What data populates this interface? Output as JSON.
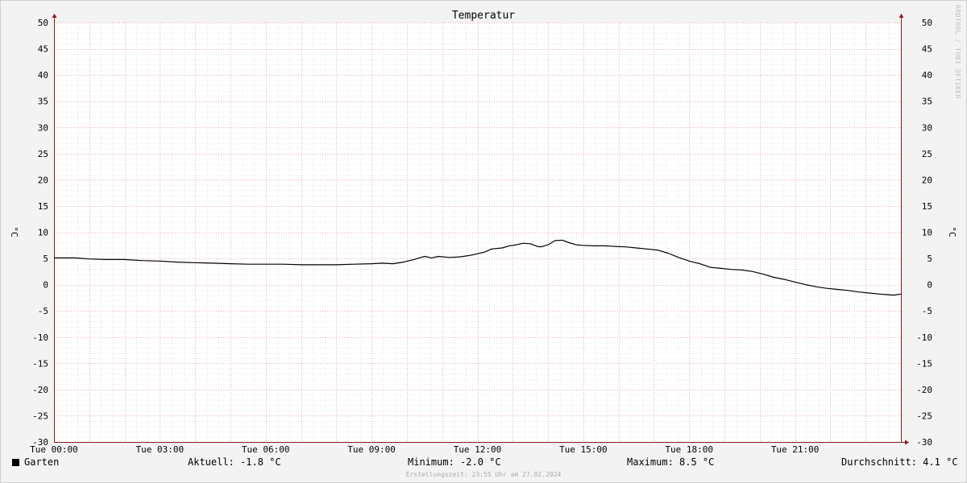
{
  "chart_data": {
    "type": "line",
    "title": "Temperatur",
    "ylabel": "°C",
    "ylabel_right": "°C",
    "ylim": [
      -30,
      50
    ],
    "yticks": [
      -30,
      -25,
      -20,
      -15,
      -10,
      -5,
      0,
      5,
      10,
      15,
      20,
      25,
      30,
      35,
      40,
      45,
      50
    ],
    "xlim": [
      0,
      24
    ],
    "xticks": [
      {
        "value": 0,
        "label": "Tue 00:00"
      },
      {
        "value": 3,
        "label": "Tue 03:00"
      },
      {
        "value": 6,
        "label": "Tue 06:00"
      },
      {
        "value": 9,
        "label": "Tue 09:00"
      },
      {
        "value": 12,
        "label": "Tue 12:00"
      },
      {
        "value": 15,
        "label": "Tue 15:00"
      },
      {
        "value": 18,
        "label": "Tue 18:00"
      },
      {
        "value": 21,
        "label": "Tue 21:00"
      }
    ],
    "grid": true,
    "legend_position": "bottom-left",
    "series": [
      {
        "name": "Garten",
        "color": "#000000",
        "x": [
          0,
          0.6,
          1,
          1.5,
          2,
          2.5,
          3,
          3.5,
          4,
          4.5,
          5,
          5.5,
          6,
          6.5,
          7,
          7.5,
          8,
          8.5,
          9,
          9.3,
          9.6,
          9.9,
          10.2,
          10.4,
          10.5,
          10.7,
          10.9,
          11.2,
          11.5,
          11.8,
          12,
          12.2,
          12.4,
          12.7,
          12.9,
          13.1,
          13.3,
          13.5,
          13.7,
          13.8,
          14.0,
          14.2,
          14.4,
          14.6,
          14.8,
          15.0,
          15.3,
          15.6,
          15.9,
          16.2,
          16.5,
          16.8,
          17.1,
          17.4,
          17.7,
          18.0,
          18.3,
          18.6,
          18.9,
          19.2,
          19.5,
          19.8,
          20.1,
          20.4,
          20.7,
          21.0,
          21.3,
          21.6,
          21.9,
          22.2,
          22.5,
          22.8,
          23.1,
          23.4,
          23.6,
          23.8,
          24
        ],
        "values": [
          5.1,
          5.1,
          4.9,
          4.8,
          4.8,
          4.6,
          4.5,
          4.3,
          4.2,
          4.1,
          4.0,
          3.9,
          3.9,
          3.9,
          3.8,
          3.8,
          3.8,
          3.9,
          4.0,
          4.1,
          4.0,
          4.3,
          4.8,
          5.2,
          5.4,
          5.1,
          5.4,
          5.2,
          5.3,
          5.6,
          5.9,
          6.2,
          6.8,
          7.0,
          7.4,
          7.6,
          7.9,
          7.8,
          7.3,
          7.2,
          7.6,
          8.4,
          8.5,
          8.0,
          7.6,
          7.5,
          7.4,
          7.4,
          7.3,
          7.2,
          7.0,
          6.8,
          6.6,
          6.0,
          5.2,
          4.5,
          4.0,
          3.3,
          3.1,
          2.9,
          2.8,
          2.5,
          2.0,
          1.4,
          1.0,
          0.5,
          0.0,
          -0.4,
          -0.7,
          -0.9,
          -1.1,
          -1.4,
          -1.6,
          -1.8,
          -1.9,
          -2.0,
          -1.8
        ]
      }
    ]
  },
  "legend": {
    "series_name": "Garten",
    "current": "Aktuell: -1.8 °C",
    "minimum": "Minimum: -2.0 °C",
    "maximum": "Maximum: 8.5 °C",
    "average": "Durchschnitt: 4.1 °C"
  },
  "footer": "Erstellungszeit: 23:55 Uhr am 27.02.2024",
  "watermark": "RRDTOOL / TOBI OETIKER"
}
